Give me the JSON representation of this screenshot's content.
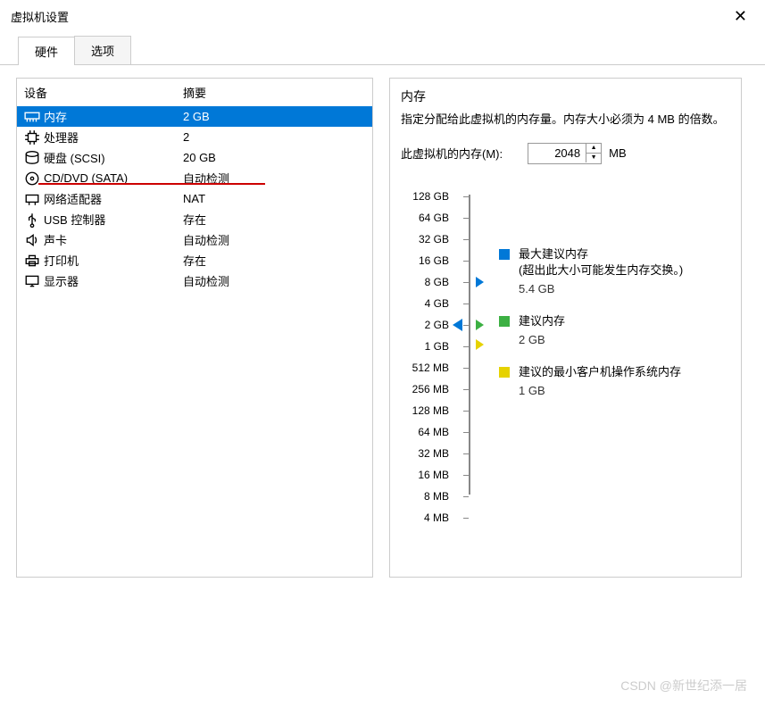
{
  "window": {
    "title": "虚拟机设置"
  },
  "tabs": {
    "hardware": "硬件",
    "options": "选项"
  },
  "hardware_list": {
    "header_device": "设备",
    "header_summary": "摘要",
    "rows": [
      {
        "name": "内存",
        "summary": "2 GB",
        "icon": "memory-icon"
      },
      {
        "name": "处理器",
        "summary": "2",
        "icon": "cpu-icon"
      },
      {
        "name": "硬盘 (SCSI)",
        "summary": "20 GB",
        "icon": "disk-icon"
      },
      {
        "name": "CD/DVD (SATA)",
        "summary": "自动检测",
        "icon": "cd-icon"
      },
      {
        "name": "网络适配器",
        "summary": "NAT",
        "icon": "network-icon"
      },
      {
        "name": "USB 控制器",
        "summary": "存在",
        "icon": "usb-icon"
      },
      {
        "name": "声卡",
        "summary": "自动检测",
        "icon": "sound-icon"
      },
      {
        "name": "打印机",
        "summary": "存在",
        "icon": "printer-icon"
      },
      {
        "name": "显示器",
        "summary": "自动检测",
        "icon": "display-icon"
      }
    ]
  },
  "memory_panel": {
    "title": "内存",
    "description": "指定分配给此虚拟机的内存量。内存大小必须为 4 MB 的倍数。",
    "input_label": "此虚拟机的内存(M):",
    "input_value": "2048",
    "unit": "MB",
    "slider_labels": [
      "128 GB",
      "64 GB",
      "32 GB",
      "16 GB",
      "8 GB",
      "4 GB",
      "2 GB",
      "1 GB",
      "512 MB",
      "256 MB",
      "128 MB",
      "64 MB",
      "32 MB",
      "16 MB",
      "8 MB",
      "4 MB"
    ],
    "legend": {
      "max": {
        "label": "最大建议内存",
        "note": "(超出此大小可能发生内存交换。)",
        "value": "5.4 GB",
        "color": "#0078d7"
      },
      "rec": {
        "label": "建议内存",
        "value": "2 GB",
        "color": "#3cb043"
      },
      "min": {
        "label": "建议的最小客户机操作系统内存",
        "value": "1 GB",
        "color": "#e6d200"
      }
    }
  },
  "watermark": "CSDN @新世纪添一居"
}
